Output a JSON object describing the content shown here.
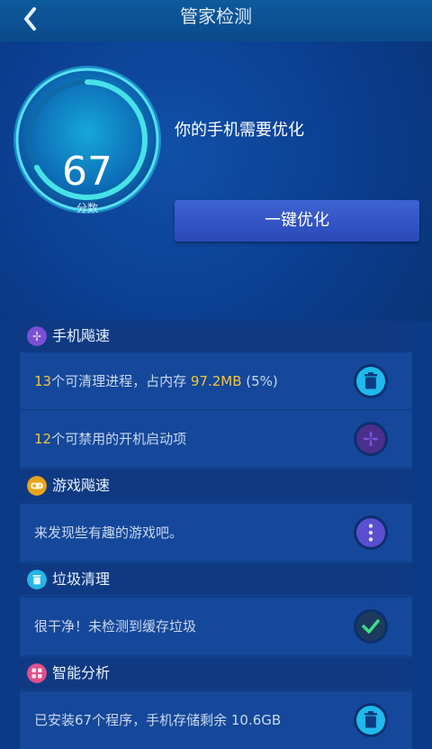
{
  "header": {
    "title": "管家检测",
    "back_icon": "chevron-left-icon"
  },
  "hero": {
    "score": "67",
    "score_label": "分数",
    "score_fraction": 0.67,
    "hint": "你的手机需要优化",
    "optimize_button": "一键优化"
  },
  "sections": {
    "speed": {
      "title": "手机飚速",
      "icon": "fan-icon",
      "color": "#7a4fd6",
      "row1": {
        "count": "13",
        "text_a": "个可清理进程，占内存 ",
        "mem": "97.2MB",
        "text_b": " (5%)",
        "icon": "trash-icon"
      },
      "row2": {
        "count": "12",
        "text": "个可禁用的开机启动项",
        "icon": "fan-icon"
      }
    },
    "game": {
      "title": "游戏飚速",
      "icon": "gamepad-icon",
      "color": "#e8a31c",
      "row": {
        "text": "来发现些有趣的游戏吧。",
        "icon": "more-icon"
      }
    },
    "junk": {
      "title": "垃圾清理",
      "icon": "trash-icon",
      "color": "#25b5e6",
      "row": {
        "text": "很干净！未检测到缓存垃圾",
        "icon": "check-icon"
      }
    },
    "analysis": {
      "title": "智能分析",
      "icon": "grid-icon",
      "color": "#e0508a",
      "row": {
        "text": "已安装67个程序，手机存储剩余 10.6GB",
        "icon": "trash-icon"
      }
    }
  },
  "colors": {
    "accent": "#2fc3e8",
    "highlight": "#f2c53b",
    "button": "#3557c8"
  }
}
